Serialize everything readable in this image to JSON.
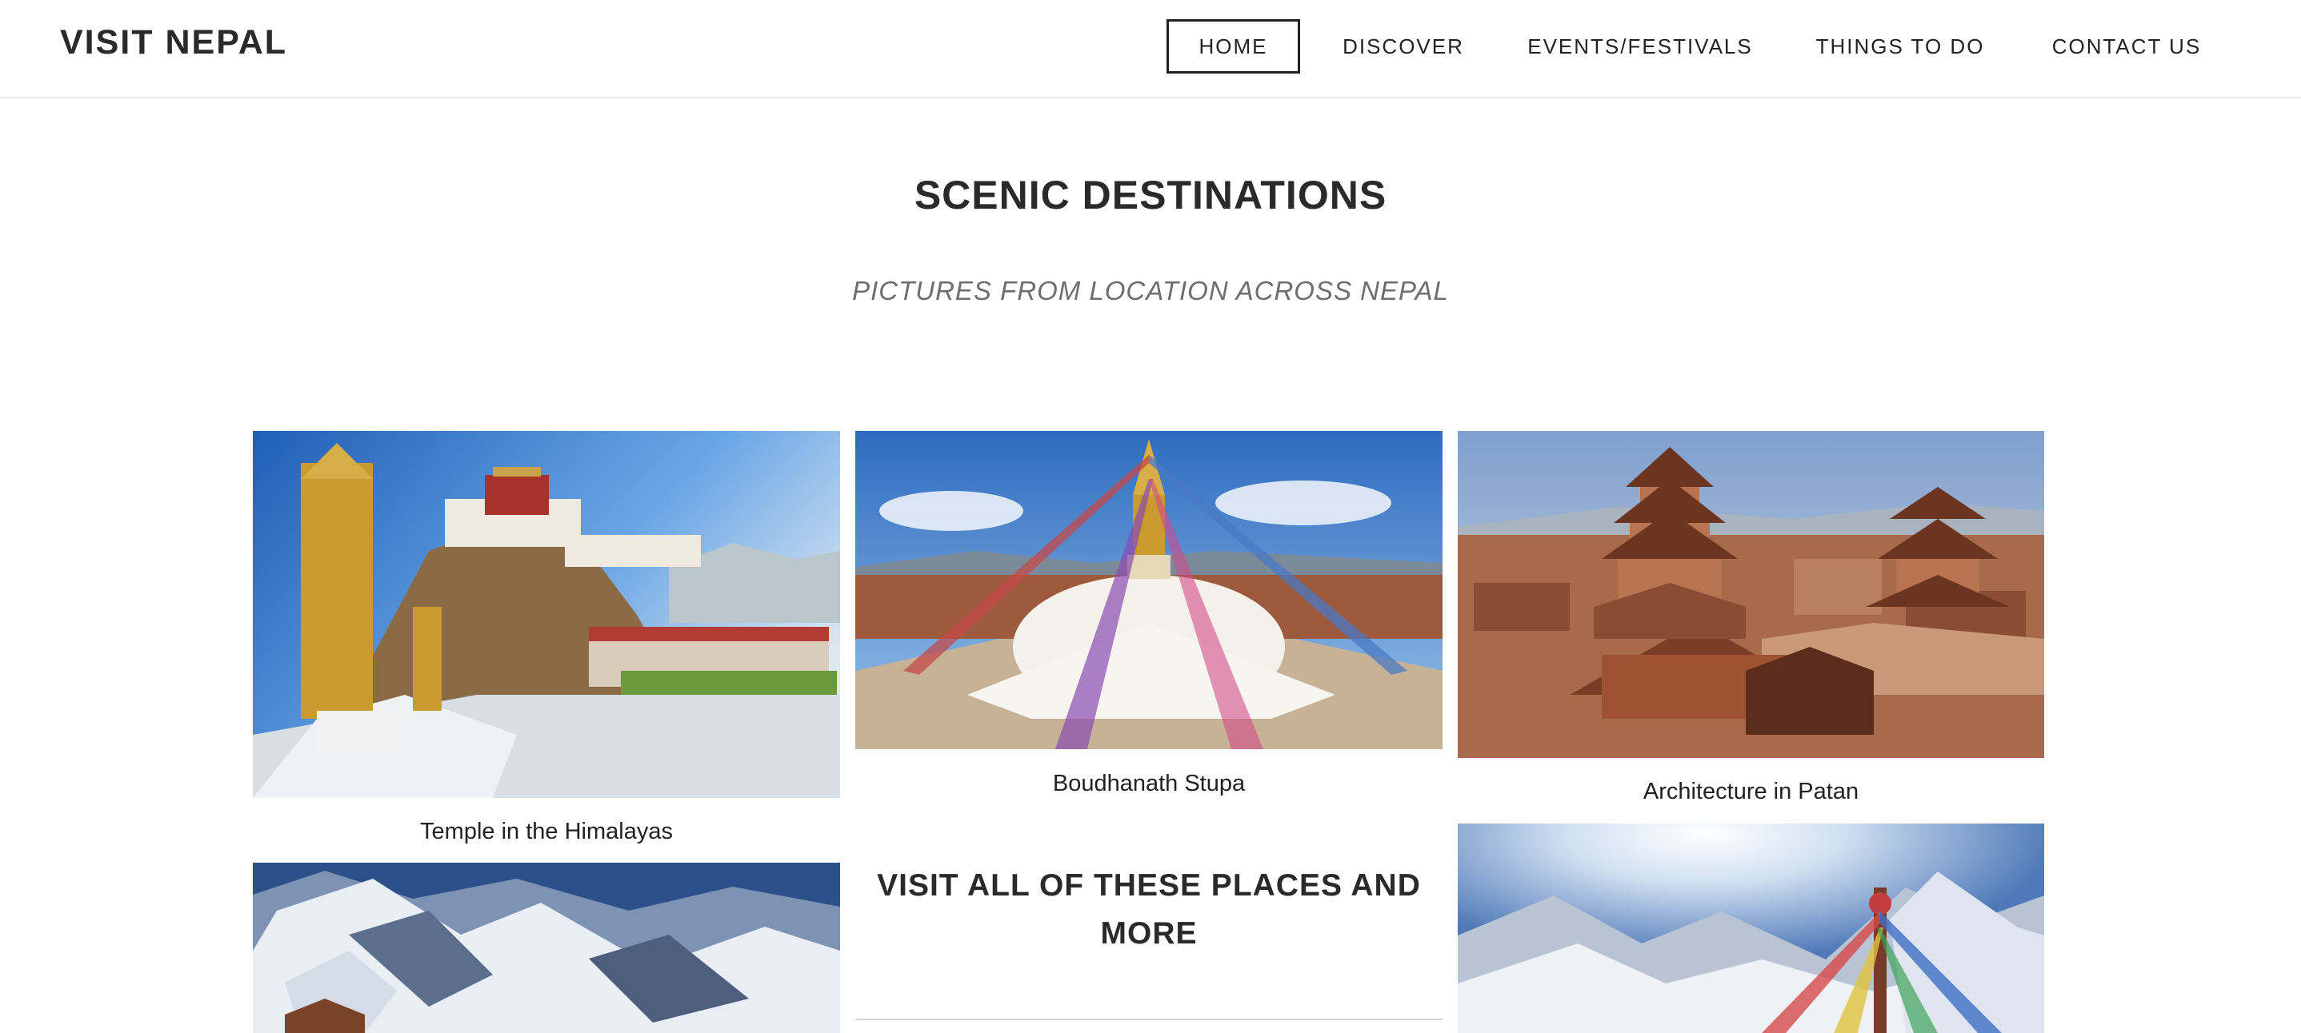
{
  "header": {
    "brand": "VISIT NEPAL",
    "nav": [
      {
        "label": "HOME",
        "active": true
      },
      {
        "label": "DISCOVER",
        "active": false
      },
      {
        "label": "EVENTS/FESTIVALS",
        "active": false
      },
      {
        "label": "THINGS TO DO",
        "active": false
      },
      {
        "label": "CONTACT US",
        "active": false
      }
    ]
  },
  "section": {
    "title": "SCENIC DESTINATIONS",
    "subtitle": "PICTURES FROM LOCATION ACROSS NEPAL"
  },
  "gallery": {
    "captions": {
      "temple": "Temple in the Himalayas",
      "stupa": "Boudhanath Stupa",
      "patan": "Architecture in Patan"
    },
    "cta": "VISIT ALL OF THESE PLACES AND MORE"
  },
  "colors": {
    "text": "#2a2a2a",
    "subtitle": "#6e6e6e",
    "border": "#eeeeee",
    "sky": "#3f7fd0"
  }
}
